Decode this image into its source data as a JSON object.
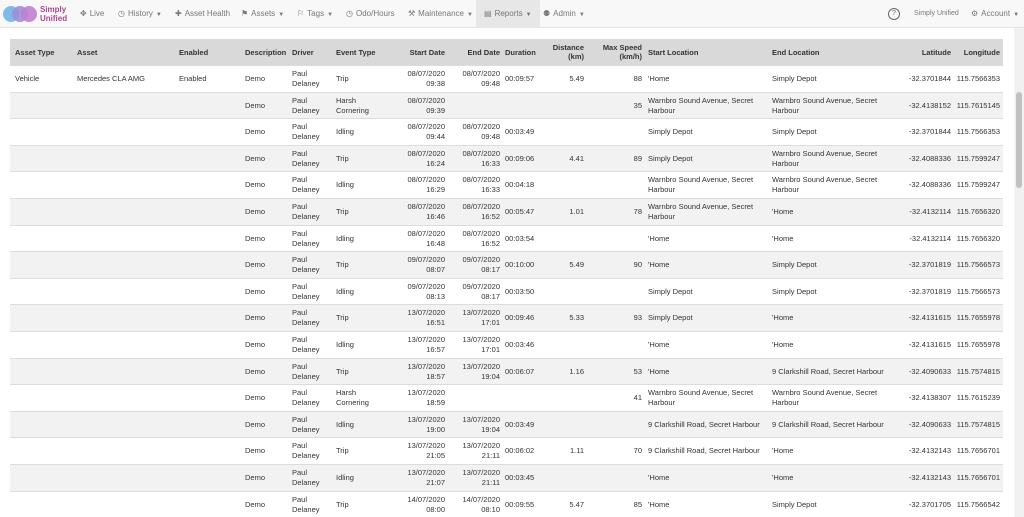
{
  "nav": {
    "logo_text": "Simply\nUnified",
    "items": [
      {
        "label": "Live",
        "icon": "✥"
      },
      {
        "label": "History",
        "icon": "◷"
      },
      {
        "label": "Asset Health",
        "icon": "✚"
      },
      {
        "label": "Assets",
        "icon": "⚑"
      },
      {
        "label": "Tags",
        "icon": "⚐"
      },
      {
        "label": "Odo/Hours",
        "icon": "◷"
      },
      {
        "label": "Maintenance",
        "icon": "⚒"
      },
      {
        "label": "Reports",
        "icon": "▤"
      },
      {
        "label": "Admin",
        "icon": "⚉"
      }
    ],
    "help_icon": "?",
    "company": "Simply Unified",
    "account_label": "Account",
    "account_icon": "⚙"
  },
  "table": {
    "headers": {
      "asset_type": "Asset Type",
      "asset": "Asset",
      "enabled": "Enabled",
      "description": "Description",
      "driver": "Driver",
      "event_type": "Event Type",
      "start_date": "Start Date",
      "end_date": "End Date",
      "duration": "Duration",
      "distance": "Distance\n(km)",
      "max_speed": "Max Speed\n(km/h)",
      "start_location": "Start Location",
      "end_location": "End Location",
      "latitude": "Latitude",
      "longitude": "Longitude"
    },
    "rows": [
      {
        "asset_type": "Vehicle",
        "asset": "Mercedes CLA AMG",
        "enabled": "Enabled",
        "description": "Demo",
        "driver": "Paul\nDelaney",
        "event_type": "Trip",
        "start_date": "08/07/2020\n09:38",
        "end_date": "08/07/2020\n09:48",
        "duration": "00:09:57",
        "distance": "5.49",
        "max_speed": "88",
        "start_location": "'Home",
        "end_location": "Simply Depot",
        "latitude": "-32.3701844",
        "longitude": "115.7566353"
      },
      {
        "asset_type": "",
        "asset": "",
        "enabled": "",
        "description": "Demo",
        "driver": "Paul\nDelaney",
        "event_type": "Harsh\nCornering",
        "start_date": "08/07/2020\n09:39",
        "end_date": "",
        "duration": "",
        "distance": "",
        "max_speed": "35",
        "start_location": "Warnbro Sound Avenue, Secret\nHarbour",
        "end_location": "Warnbro Sound Avenue, Secret\nHarbour",
        "latitude": "-32.4138152",
        "longitude": "115.7615145"
      },
      {
        "asset_type": "",
        "asset": "",
        "enabled": "",
        "description": "Demo",
        "driver": "Paul\nDelaney",
        "event_type": "Idling",
        "start_date": "08/07/2020\n09:44",
        "end_date": "08/07/2020\n09:48",
        "duration": "00:03:49",
        "distance": "",
        "max_speed": "",
        "start_location": "Simply Depot",
        "end_location": "Simply Depot",
        "latitude": "-32.3701844",
        "longitude": "115.7566353"
      },
      {
        "asset_type": "",
        "asset": "",
        "enabled": "",
        "description": "Demo",
        "driver": "Paul\nDelaney",
        "event_type": "Trip",
        "start_date": "08/07/2020\n16:24",
        "end_date": "08/07/2020\n16:33",
        "duration": "00:09:06",
        "distance": "4.41",
        "max_speed": "89",
        "start_location": "Simply Depot",
        "end_location": "Warnbro Sound Avenue, Secret\nHarbour",
        "latitude": "-32.4088336",
        "longitude": "115.7599247"
      },
      {
        "asset_type": "",
        "asset": "",
        "enabled": "",
        "description": "Demo",
        "driver": "Paul\nDelaney",
        "event_type": "Idling",
        "start_date": "08/07/2020\n16:29",
        "end_date": "08/07/2020\n16:33",
        "duration": "00:04:18",
        "distance": "",
        "max_speed": "",
        "start_location": "Warnbro Sound Avenue, Secret\nHarbour",
        "end_location": "Warnbro Sound Avenue, Secret\nHarbour",
        "latitude": "-32.4088336",
        "longitude": "115.7599247"
      },
      {
        "asset_type": "",
        "asset": "",
        "enabled": "",
        "description": "Demo",
        "driver": "Paul\nDelaney",
        "event_type": "Trip",
        "start_date": "08/07/2020\n16:46",
        "end_date": "08/07/2020\n16:52",
        "duration": "00:05:47",
        "distance": "1.01",
        "max_speed": "78",
        "start_location": "Warnbro Sound Avenue, Secret\nHarbour",
        "end_location": "'Home",
        "latitude": "-32.4132114",
        "longitude": "115.7656320"
      },
      {
        "asset_type": "",
        "asset": "",
        "enabled": "",
        "description": "Demo",
        "driver": "Paul\nDelaney",
        "event_type": "Idling",
        "start_date": "08/07/2020\n16:48",
        "end_date": "08/07/2020\n16:52",
        "duration": "00:03:54",
        "distance": "",
        "max_speed": "",
        "start_location": "'Home",
        "end_location": "'Home",
        "latitude": "-32.4132114",
        "longitude": "115.7656320"
      },
      {
        "asset_type": "",
        "asset": "",
        "enabled": "",
        "description": "Demo",
        "driver": "Paul\nDelaney",
        "event_type": "Trip",
        "start_date": "09/07/2020\n08:07",
        "end_date": "09/07/2020\n08:17",
        "duration": "00:10:00",
        "distance": "5.49",
        "max_speed": "90",
        "start_location": "'Home",
        "end_location": "Simply Depot",
        "latitude": "-32.3701819",
        "longitude": "115.7566573"
      },
      {
        "asset_type": "",
        "asset": "",
        "enabled": "",
        "description": "Demo",
        "driver": "Paul\nDelaney",
        "event_type": "Idling",
        "start_date": "09/07/2020\n08:13",
        "end_date": "09/07/2020\n08:17",
        "duration": "00:03:50",
        "distance": "",
        "max_speed": "",
        "start_location": "Simply Depot",
        "end_location": "Simply Depot",
        "latitude": "-32.3701819",
        "longitude": "115.7566573"
      },
      {
        "asset_type": "",
        "asset": "",
        "enabled": "",
        "description": "Demo",
        "driver": "Paul\nDelaney",
        "event_type": "Trip",
        "start_date": "13/07/2020\n16:51",
        "end_date": "13/07/2020\n17:01",
        "duration": "00:09:46",
        "distance": "5.33",
        "max_speed": "93",
        "start_location": "Simply Depot",
        "end_location": "'Home",
        "latitude": "-32.4131615",
        "longitude": "115.7655978"
      },
      {
        "asset_type": "",
        "asset": "",
        "enabled": "",
        "description": "Demo",
        "driver": "Paul\nDelaney",
        "event_type": "Idling",
        "start_date": "13/07/2020\n16:57",
        "end_date": "13/07/2020\n17:01",
        "duration": "00:03:46",
        "distance": "",
        "max_speed": "",
        "start_location": "'Home",
        "end_location": "'Home",
        "latitude": "-32.4131615",
        "longitude": "115.7655978"
      },
      {
        "asset_type": "",
        "asset": "",
        "enabled": "",
        "description": "Demo",
        "driver": "Paul\nDelaney",
        "event_type": "Trip",
        "start_date": "13/07/2020\n18:57",
        "end_date": "13/07/2020\n19:04",
        "duration": "00:06:07",
        "distance": "1.16",
        "max_speed": "53",
        "start_location": "'Home",
        "end_location": "9 Clarkshill Road, Secret Harbour",
        "latitude": "-32.4090633",
        "longitude": "115.7574815"
      },
      {
        "asset_type": "",
        "asset": "",
        "enabled": "",
        "description": "Demo",
        "driver": "Paul\nDelaney",
        "event_type": "Harsh\nCornering",
        "start_date": "13/07/2020\n18:59",
        "end_date": "",
        "duration": "",
        "distance": "",
        "max_speed": "41",
        "start_location": "Warnbro Sound Avenue, Secret\nHarbour",
        "end_location": "Warnbro Sound Avenue, Secret\nHarbour",
        "latitude": "-32.4138307",
        "longitude": "115.7615239"
      },
      {
        "asset_type": "",
        "asset": "",
        "enabled": "",
        "description": "Demo",
        "driver": "Paul\nDelaney",
        "event_type": "Idling",
        "start_date": "13/07/2020\n19:00",
        "end_date": "13/07/2020\n19:04",
        "duration": "00:03:49",
        "distance": "",
        "max_speed": "",
        "start_location": "9 Clarkshill Road, Secret Harbour",
        "end_location": "9 Clarkshill Road, Secret Harbour",
        "latitude": "-32.4090633",
        "longitude": "115.7574815"
      },
      {
        "asset_type": "",
        "asset": "",
        "enabled": "",
        "description": "Demo",
        "driver": "Paul\nDelaney",
        "event_type": "Trip",
        "start_date": "13/07/2020\n21:05",
        "end_date": "13/07/2020\n21:11",
        "duration": "00:06:02",
        "distance": "1.11",
        "max_speed": "70",
        "start_location": "9 Clarkshill Road, Secret Harbour",
        "end_location": "'Home",
        "latitude": "-32.4132143",
        "longitude": "115.7656701"
      },
      {
        "asset_type": "",
        "asset": "",
        "enabled": "",
        "description": "Demo",
        "driver": "Paul\nDelaney",
        "event_type": "Idling",
        "start_date": "13/07/2020\n21:07",
        "end_date": "13/07/2020\n21:11",
        "duration": "00:03:45",
        "distance": "",
        "max_speed": "",
        "start_location": "'Home",
        "end_location": "'Home",
        "latitude": "-32.4132143",
        "longitude": "115.7656701"
      },
      {
        "asset_type": "",
        "asset": "",
        "enabled": "",
        "description": "Demo",
        "driver": "Paul\nDelaney",
        "event_type": "Trip",
        "start_date": "14/07/2020\n08:00",
        "end_date": "14/07/2020\n08:10",
        "duration": "00:09:55",
        "distance": "5.47",
        "max_speed": "85",
        "start_location": "'Home",
        "end_location": "Simply Depot",
        "latitude": "-32.3701705",
        "longitude": "115.7566542"
      }
    ]
  }
}
